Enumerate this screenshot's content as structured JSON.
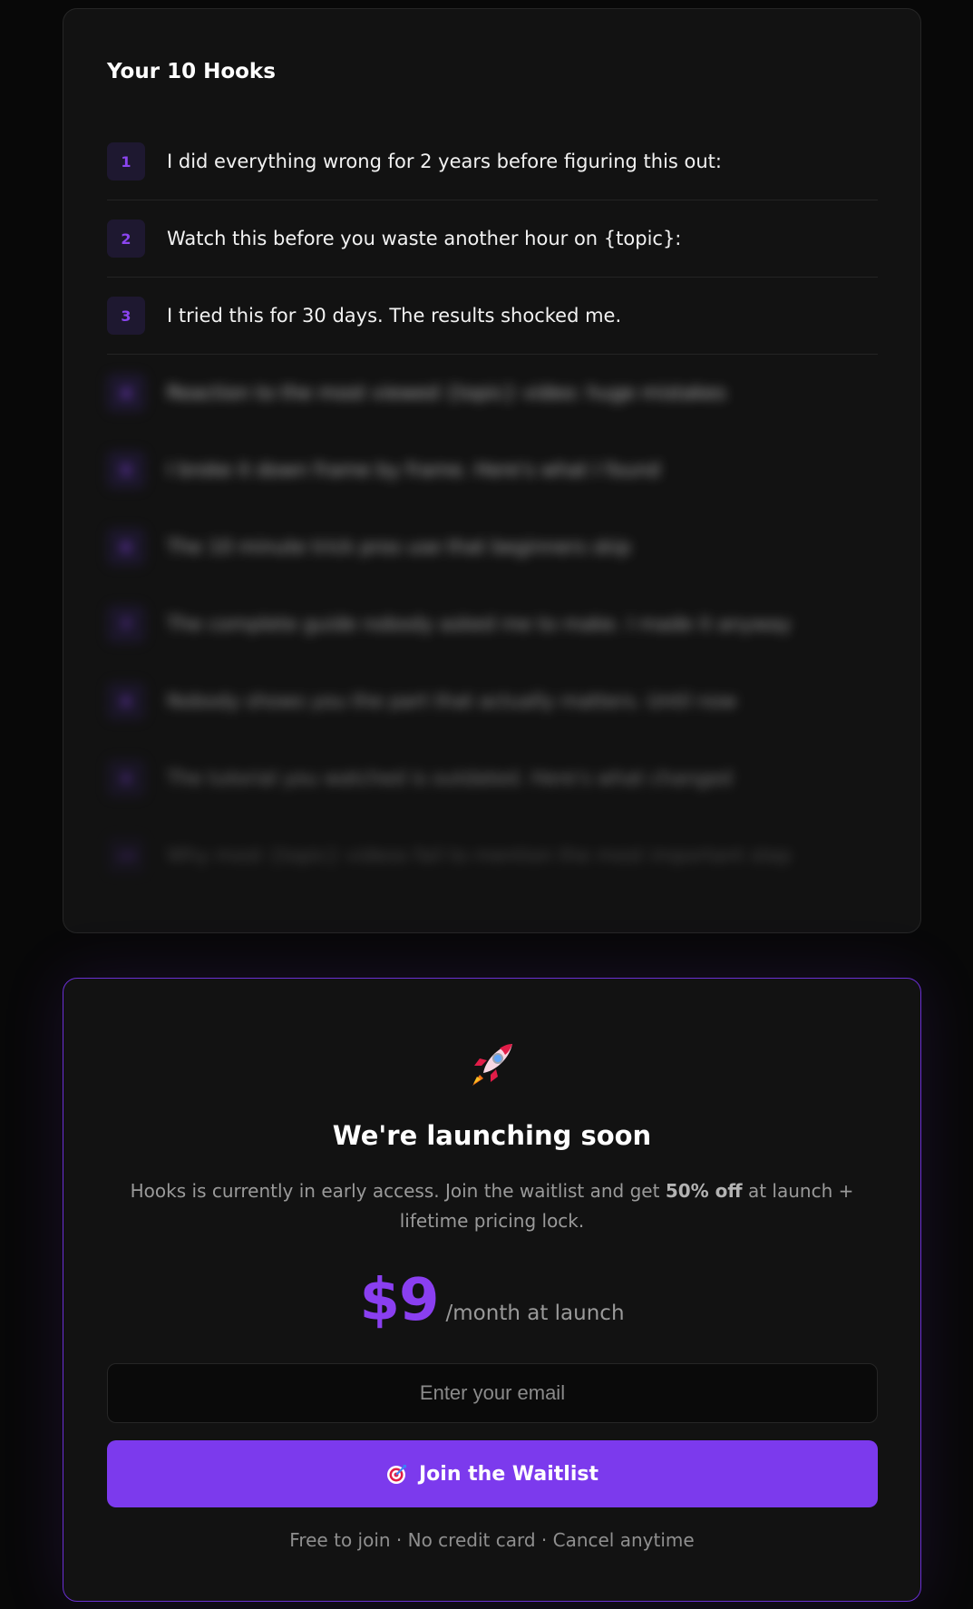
{
  "hooks_card": {
    "title": "Your 10 Hooks",
    "hooks": [
      {
        "num": "1",
        "text": "I did everything wrong for 2 years before figuring this out:"
      },
      {
        "num": "2",
        "text": "Watch this before you waste another hour on {topic}:"
      },
      {
        "num": "3",
        "text": "I tried this for 30 days. The results shocked me."
      },
      {
        "num": "4",
        "text": "Reaction to the most viewed {topic} video: huge mistakes"
      },
      {
        "num": "5",
        "text": "I broke it down frame by frame. Here's what I found"
      },
      {
        "num": "6",
        "text": "The 10 minute trick pros use that beginners skip"
      },
      {
        "num": "7",
        "text": "The complete guide nobody asked me to make. I made it anyway"
      },
      {
        "num": "8",
        "text": "Nobody shows you the part that actually matters. Until now"
      },
      {
        "num": "9",
        "text": "The tutorial you watched is outdated. Here's what changed"
      },
      {
        "num": "10",
        "text": "Why most {topic} videos fail to mention the most important step"
      }
    ]
  },
  "waitlist_card": {
    "icon": "rocket-icon",
    "title": "We're launching soon",
    "description_before": "Hooks is currently in early access. Join the waitlist and get ",
    "description_bold": "50% off",
    "description_after": " at launch + lifetime pricing lock.",
    "price": "$9",
    "price_unit": "/month at launch",
    "email_placeholder": "Enter your email",
    "button_icon": "target-icon",
    "button_label": "Join the Waitlist",
    "fineprint": "Free to join · No credit card · Cancel anytime"
  },
  "colors": {
    "accent": "#7c3aed",
    "background": "#080808",
    "card": "#121212"
  }
}
